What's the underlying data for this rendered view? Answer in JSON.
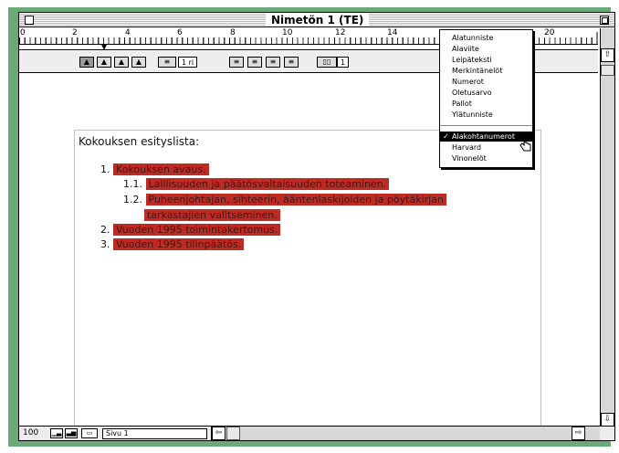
{
  "window": {
    "title": "Nimetön 1 (TE)"
  },
  "ruler": {
    "numbers": [
      "0",
      "2",
      "4",
      "6",
      "8",
      "10",
      "12",
      "14",
      "20"
    ]
  },
  "toolbar": {
    "spacing_label": "1 ri",
    "columns_label": "1"
  },
  "menu": {
    "items": [
      "Alatunniste",
      "Alaviite",
      "Leipäteksti",
      "Merkintänelöt",
      "Numerot",
      "Oletusarvo",
      "Pallot",
      "Ylätunniste"
    ],
    "items2": [
      "Alakohtanumerot",
      "Harvard",
      "Vinonelöt"
    ],
    "checked": "✓"
  },
  "document": {
    "heading": "Kokouksen esityslista:",
    "lines": [
      {
        "num": "1.",
        "text": "Kokouksen avaus."
      },
      {
        "num": "1.1.",
        "text": "Laillisuuden ja päätösvaltaisuuden toteaminen."
      },
      {
        "num": "1.2.",
        "text": "Puheenjohtajan, sihteerin, ääntenlaskijoiden ja pöytäkirjan"
      },
      {
        "num": "",
        "text": "tarkastajien valitseminen."
      },
      {
        "num": "2.",
        "text": "Vuoden 1995 toimintakertomus."
      },
      {
        "num": "3.",
        "text": "Vuoden 1995 tilinpäätös."
      }
    ]
  },
  "status": {
    "zoom": "100",
    "page": "Sivu 1"
  },
  "colors": {
    "highlight": "#bf2a22",
    "frame": "#6aaa7a"
  }
}
